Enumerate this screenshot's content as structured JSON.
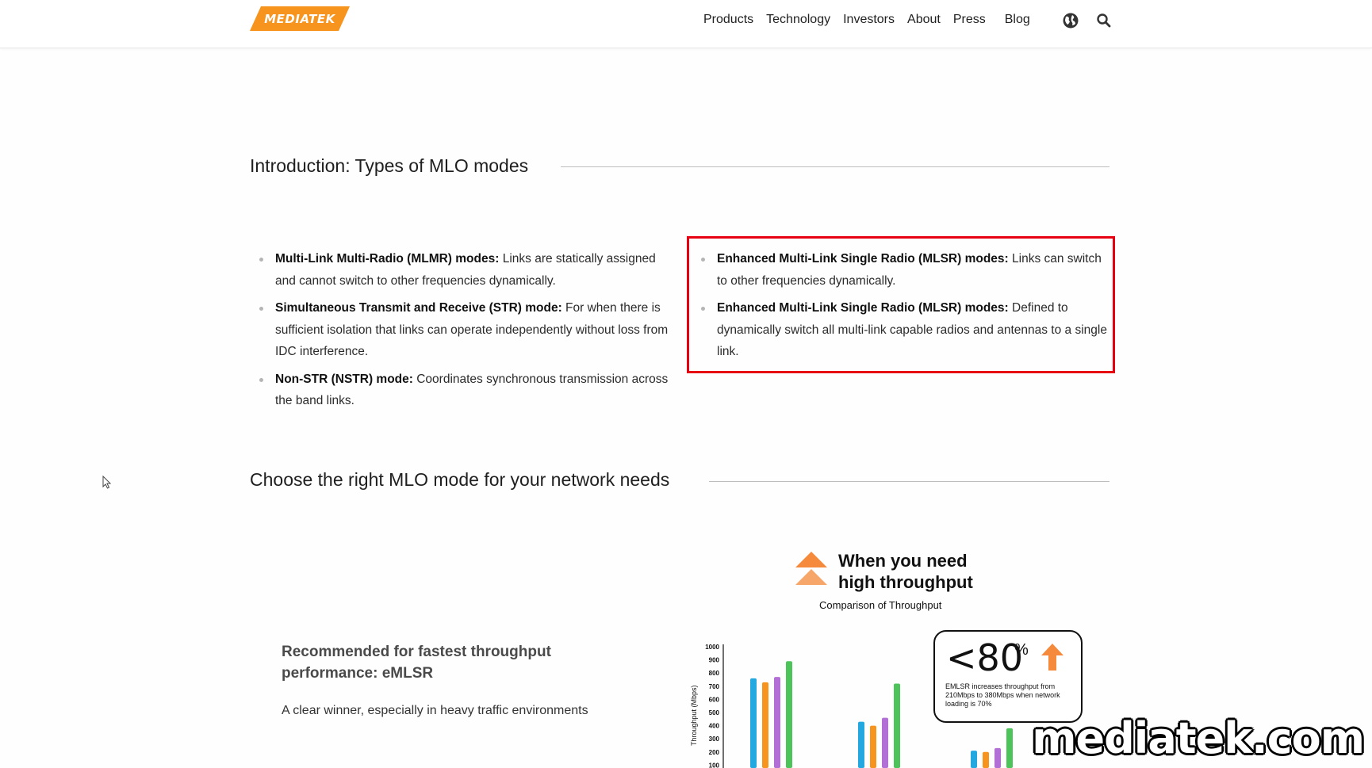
{
  "header": {
    "logo_text": "MEDIATEK",
    "brand_color": "#f7941d",
    "nav": [
      "Products",
      "Technology",
      "Investors",
      "About",
      "Press",
      "Blog"
    ],
    "icons": [
      "globe-icon",
      "search-icon"
    ]
  },
  "intro": {
    "title": "Introduction: Types of MLO modes",
    "left_items": [
      {
        "bold": "Multi-Link Multi-Radio (MLMR) modes:",
        "text": " Links are statically assigned and cannot switch to other frequencies dynamically."
      },
      {
        "bold": "Simultaneous Transmit and Receive (STR) mode:",
        "text": " For when there is sufficient isolation that links can operate independently without loss from IDC interference."
      },
      {
        "bold": "Non-STR (NSTR) mode:",
        "text": " Coordinates synchronous transmission across the band links."
      }
    ],
    "right_items": [
      {
        "bold": "Enhanced Multi-Link Single Radio (MLSR) modes:",
        "text": " Links can switch to other frequencies dynamically."
      },
      {
        "bold": "Enhanced Multi-Link Single Radio (MLSR) modes:",
        "text": " Defined to dynamically switch all multi-link capable radios and antennas to a single link."
      }
    ],
    "highlight_color": "#e60012"
  },
  "choose": {
    "title": "Choose the right MLO mode for your network needs",
    "rec_title": "Recommended for fastest throughput performance: eMLSR",
    "rec_sub": "A clear winner, especially in heavy traffic environments"
  },
  "infographic": {
    "headline_1": "When you need",
    "headline_2": "high throughput",
    "subtitle": "Comparison of Throughput",
    "callout_value": "<80",
    "callout_unit": "%",
    "callout_text": "EMLSR increases throughput from 210Mbps to 380Mbps when network loading is 70%"
  },
  "chart_data": {
    "type": "bar",
    "ylabel": "Throughput (Mbps)",
    "yticks": [
      "1000",
      "900",
      "800",
      "700",
      "600",
      "500",
      "400",
      "300",
      "200",
      "100"
    ],
    "ylim": [
      0,
      1000
    ],
    "groups": [
      {
        "values": [
          760,
          730,
          770,
          890
        ]
      },
      {
        "values": [
          430,
          400,
          460,
          720
        ]
      },
      {
        "values": [
          210,
          200,
          230,
          380
        ]
      }
    ],
    "series_colors": [
      "#23a8e0",
      "#f7941d",
      "#b26fd6",
      "#4cc45a"
    ]
  },
  "watermark": "mediatek.com"
}
